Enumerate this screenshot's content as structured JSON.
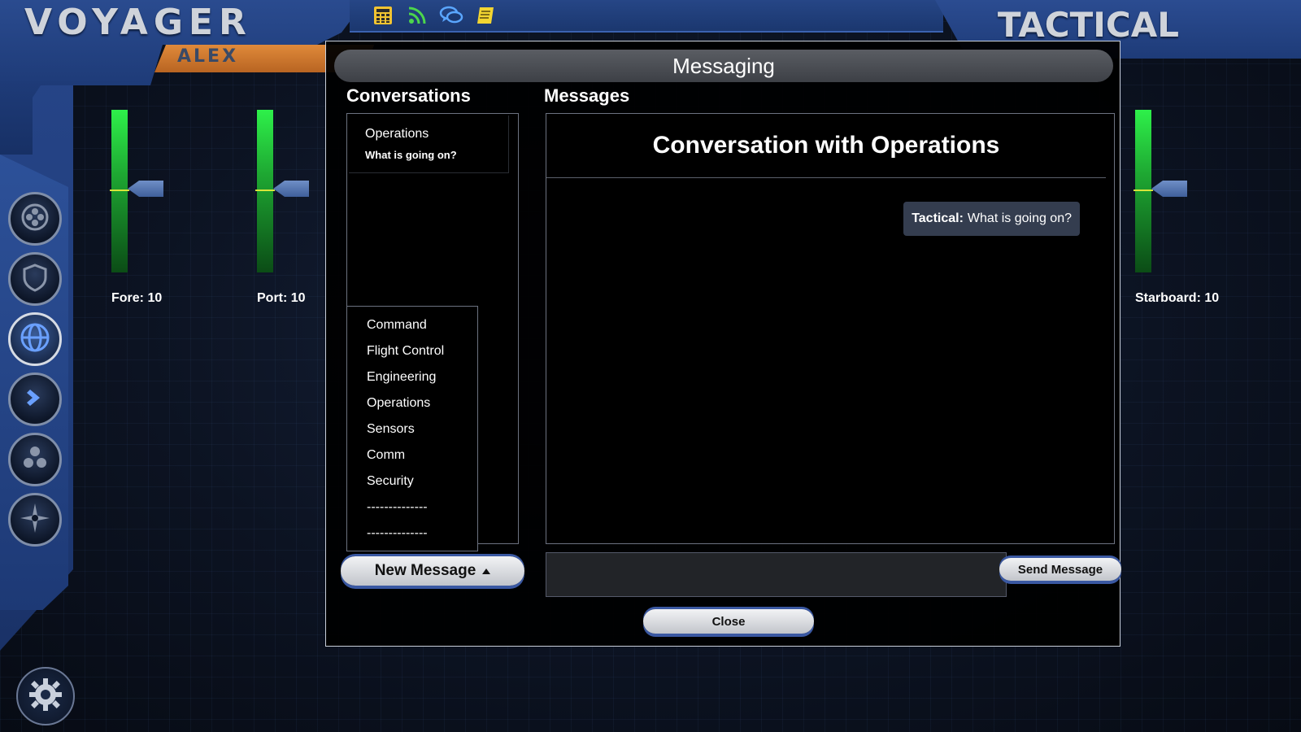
{
  "app": {
    "title": "VOYAGER",
    "user": "ALEX",
    "station": "TACTICAL"
  },
  "toolbar": [
    "calculator-icon",
    "rss-icon",
    "chat-icon",
    "notes-icon"
  ],
  "side_nav": [
    "target-icon",
    "shield-icon",
    "globe-icon",
    "chevron-right-icon",
    "radiation-icon",
    "compass-icon"
  ],
  "shields": {
    "fore_label": "Fore: 10",
    "port_label": "Port: 10",
    "starboard_label": "Starboard: 10"
  },
  "modal": {
    "title": "Messaging",
    "conversations_heading": "Conversations",
    "messages_heading": "Messages",
    "conversations": [
      {
        "name": "Operations",
        "preview": "What is going on?"
      }
    ],
    "conversation_title": "Conversation with Operations",
    "messages": [
      {
        "sender": "Tactical:",
        "text": "What is going on?"
      }
    ],
    "new_message_label": "New Message",
    "recipients": [
      "Command",
      "Flight Control",
      "Engineering",
      "Operations",
      "Sensors",
      "Comm",
      "Security",
      "--------------",
      "--------------"
    ],
    "input_value": "",
    "send_label": "Send Message",
    "close_label": "Close"
  },
  "colors": {
    "accent_blue": "#3a58a2",
    "shield_green": "#2ef04a",
    "nameplate_orange": "#e08a3a"
  }
}
